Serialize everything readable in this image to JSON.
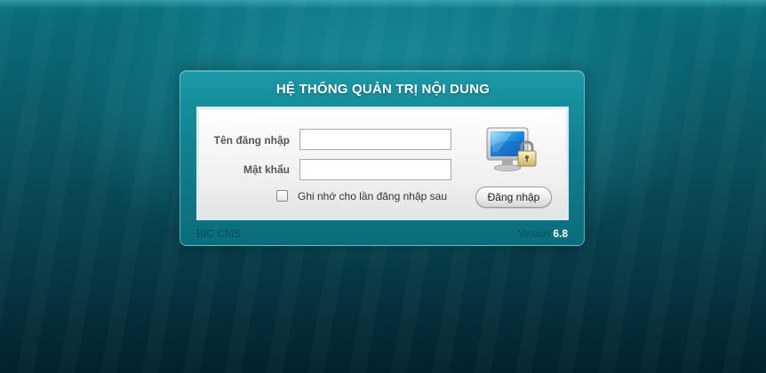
{
  "login": {
    "title": "HỆ THỐNG QUẢN TRỊ NỘI DUNG",
    "username_label": "Tên đăng nhập",
    "username_value": "",
    "password_label": "Mật khẩu",
    "password_value": "",
    "remember_label": "Ghi nhớ cho lần đăng nhập sau",
    "remember_checked": false,
    "submit_label": "Đăng nhập",
    "icon": "monitor-lock-icon"
  },
  "footer": {
    "brand": "BIC CMS",
    "version_label": "Vesion",
    "version_number": "6.8"
  },
  "colors": {
    "background": "#0a5564",
    "panel_header": "#1b98a6",
    "title_text": "#ffffff",
    "version_number": "#ffffff"
  }
}
